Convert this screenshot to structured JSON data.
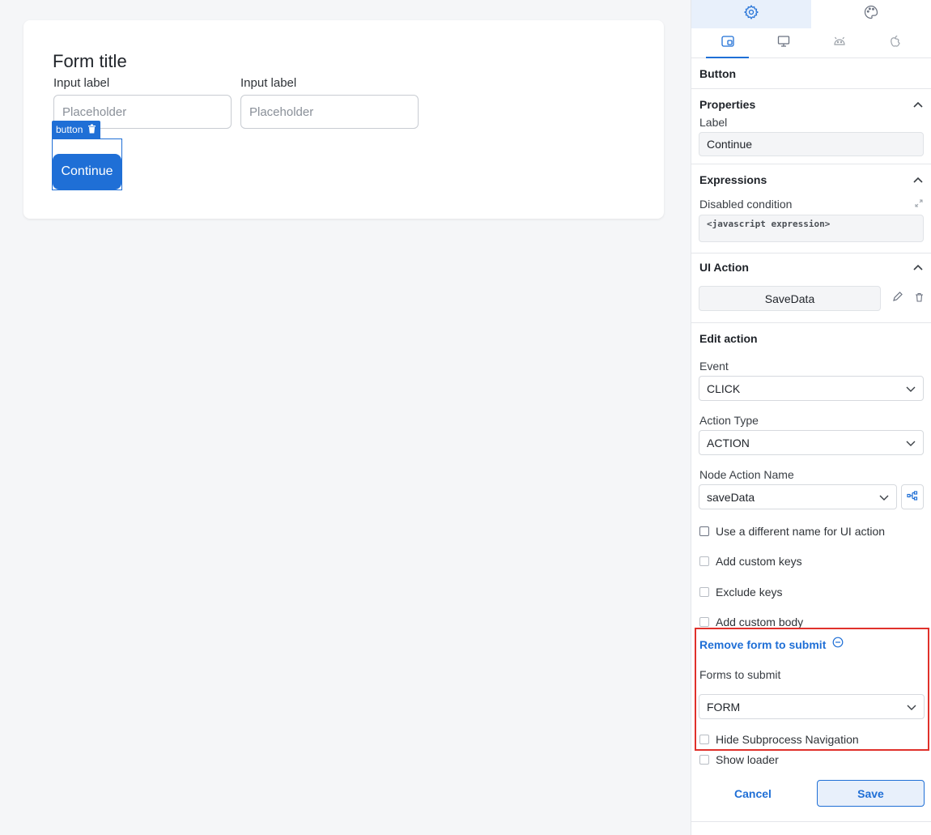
{
  "canvas": {
    "form_title": "Form title",
    "fields": [
      {
        "label": "Input label",
        "placeholder": "Placeholder"
      },
      {
        "label": "Input label",
        "placeholder": "Placeholder"
      }
    ],
    "selection_tag": "button",
    "button_label": "Continue"
  },
  "sidebar": {
    "top_tabs": [
      {
        "icon": "gear-icon"
      },
      {
        "icon": "palette-icon"
      }
    ],
    "platform_tabs": [
      {
        "icon": "tablet-icon"
      },
      {
        "icon": "desktop-icon"
      },
      {
        "icon": "android-icon"
      },
      {
        "icon": "apple-icon"
      }
    ],
    "component_name": "Button",
    "properties": {
      "title": "Properties",
      "label_caption": "Label",
      "label_value": "Continue"
    },
    "expressions": {
      "title": "Expressions",
      "disabled_caption": "Disabled condition",
      "disabled_placeholder": "<javascript expression>"
    },
    "ui_action": {
      "title": "UI Action",
      "action_name": "SaveData"
    },
    "edit_action": {
      "title": "Edit action",
      "event_caption": "Event",
      "event_value": "CLICK",
      "action_type_caption": "Action Type",
      "action_type_value": "ACTION",
      "node_action_caption": "Node Action Name",
      "node_action_value": "saveData",
      "checks": [
        "Use a different name for UI action",
        "Add custom keys",
        "Exclude keys",
        "Add custom body"
      ],
      "remove_form_link": "Remove form to submit",
      "forms_caption": "Forms to submit",
      "forms_value": "FORM",
      "hide_subprocess": "Hide Subprocess Navigation",
      "show_loader": "Show loader",
      "cancel": "Cancel",
      "save": "Save"
    }
  },
  "colors": {
    "accent": "#1f6fd6",
    "highlight": "#e0312b"
  }
}
